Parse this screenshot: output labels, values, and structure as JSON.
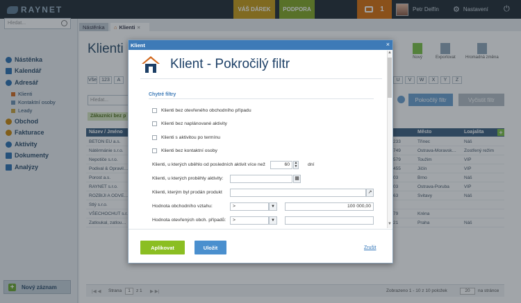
{
  "app": {
    "brand": "RAYNET"
  },
  "topbar": {
    "gift_label": "VÁŠ DÁREK",
    "support_label": "PODPORA",
    "messages_count": "1",
    "user_name": "Petr Delfín",
    "settings_label": "Nastavení"
  },
  "sidebar": {
    "search_placeholder": "Hledat...",
    "items": [
      {
        "label": "Nástěnka",
        "color": "#2a6fb0"
      },
      {
        "label": "Kalendář",
        "color": "#2a6fb0"
      },
      {
        "label": "Adresář",
        "color": "#2a6fb0"
      },
      {
        "label": "Obchod",
        "color": "#c8860a"
      },
      {
        "label": "Fakturace",
        "color": "#c8860a"
      },
      {
        "label": "Aktivity",
        "color": "#2a6fb0"
      },
      {
        "label": "Dokumenty",
        "color": "#2a6fb0"
      },
      {
        "label": "Analýzy",
        "color": "#2a6fb0"
      }
    ],
    "subitems": [
      "Klienti",
      "Kontaktní osoby",
      "Leady"
    ],
    "new_record_label": "Nový záznam"
  },
  "tabs": [
    {
      "label": "Nástěnka"
    },
    {
      "label": "Klienti"
    }
  ],
  "page": {
    "title": "Klienti",
    "toolbar": [
      "Nový",
      "Exportovat",
      "Hromadná změna"
    ],
    "alphabet": [
      "Vše",
      "123",
      "A",
      "U",
      "V",
      "W",
      "X",
      "Y",
      "Z"
    ],
    "filter_placeholder": "Hledat...",
    "advanced_filter_label": "Pokročilý filtr",
    "search_filter_label": "Vyčistit filtr",
    "saved_filter_label": "Zákazníci bez p",
    "columns": [
      "Název / Jméno",
      "Město",
      "Loajalita"
    ],
    "rows": [
      {
        "name": "BETON EU a.s.",
        "code": "233",
        "city": "Třinec",
        "loyalty": "Náš"
      },
      {
        "name": "Nátěrmánie s.r.o.",
        "code": "749",
        "city": "Ostrava-Moravsk…",
        "loyalty": "Zostřený režim"
      },
      {
        "name": "Nepotiče s.r.o.",
        "code": "579",
        "city": "Toužim",
        "loyalty": "VIP"
      },
      {
        "name": "Podival & Opravil…",
        "code": "455",
        "city": "Jičín",
        "loyalty": "VIP"
      },
      {
        "name": "Porost a.s.",
        "code": "03",
        "city": "Brno",
        "loyalty": "Náš"
      },
      {
        "name": "RAYNET s.r.o.",
        "code": "03",
        "city": "Ostrava-Poruba",
        "loyalty": "VIP"
      },
      {
        "name": "ROZBIJI A ODVE…",
        "code": "63",
        "city": "Svitavy",
        "loyalty": "Náš"
      },
      {
        "name": "Stlý s.r.o.",
        "code": "",
        "city": "",
        "loyalty": ""
      },
      {
        "name": "VŠECHOCHUT s.r.o.",
        "code": "79",
        "city": "Kréna",
        "loyalty": ""
      },
      {
        "name": "Zatloukal, zatlou…",
        "code": "21",
        "city": "Praha",
        "loyalty": "Náš"
      }
    ],
    "pager": {
      "page_label": "Strana",
      "page_value": "1",
      "of_label": "z 1",
      "summary": "Zobrazeno 1 - 10 z 10 položek",
      "per_page": "20",
      "per_page_label": "na stránce"
    }
  },
  "modal": {
    "window_title": "Klient",
    "close_glyph": "×",
    "title": "Klient - Pokročilý filtr",
    "section_label": "Chytré filtry",
    "checkboxes": [
      "Klienti bez otevřeného obchodního případu",
      "Klienti bez naplánované aktivity",
      "Klienti s aktivitou po termínu",
      "Klienti bez kontaktní osoby"
    ],
    "days_label": "Klienti, u kterých uběhlo od posledních aktivit více než",
    "days_value": "60",
    "days_unit": "dní",
    "past_activity_label": "Klienti, u kterých proběhly aktivity:",
    "product_label": "Klienti, kterým byl prodán produkt",
    "deal_value_label": "Hodnota obchodního vztahu:",
    "deal_value_op": ">",
    "deal_value": "100 000,00",
    "open_deals_label": "Hodnota otevřených obch. případů:",
    "open_deals_op": ">",
    "apply_label": "Aplikovat",
    "save_label": "Uložit",
    "cancel_label": "Zrušit"
  }
}
